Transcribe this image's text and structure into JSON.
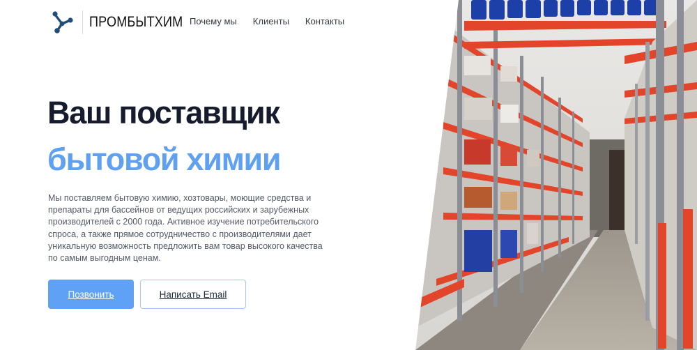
{
  "header": {
    "logo_text": "ПРОМБЫТХИМ",
    "nav": [
      {
        "label": "Почему мы"
      },
      {
        "label": "Клиенты"
      },
      {
        "label": "Контакты"
      }
    ]
  },
  "hero": {
    "title": "Ваш поставщик",
    "title_accent": "бытовой химии",
    "description": "Мы поставляем бытовую химию, хозтовары, моющие средства и препараты для бассейнов от ведущих российских и зарубежных производителей с 2000 года. Активное изучение потребительского спроса, а также прямое сотрудничество с производителями дает уникальную возможность предложить вам товар высокого качества по самым выгодным ценам.",
    "buttons": {
      "call": "Позвонить",
      "email": "Написать Email"
    }
  },
  "colors": {
    "accent": "#5fa1f0",
    "heading": "#161c2d",
    "body_text": "#525a66",
    "logo_blue": "#1f4e79",
    "rack_orange": "#e2452a"
  },
  "icons": {
    "logo": "molecule-icon"
  }
}
